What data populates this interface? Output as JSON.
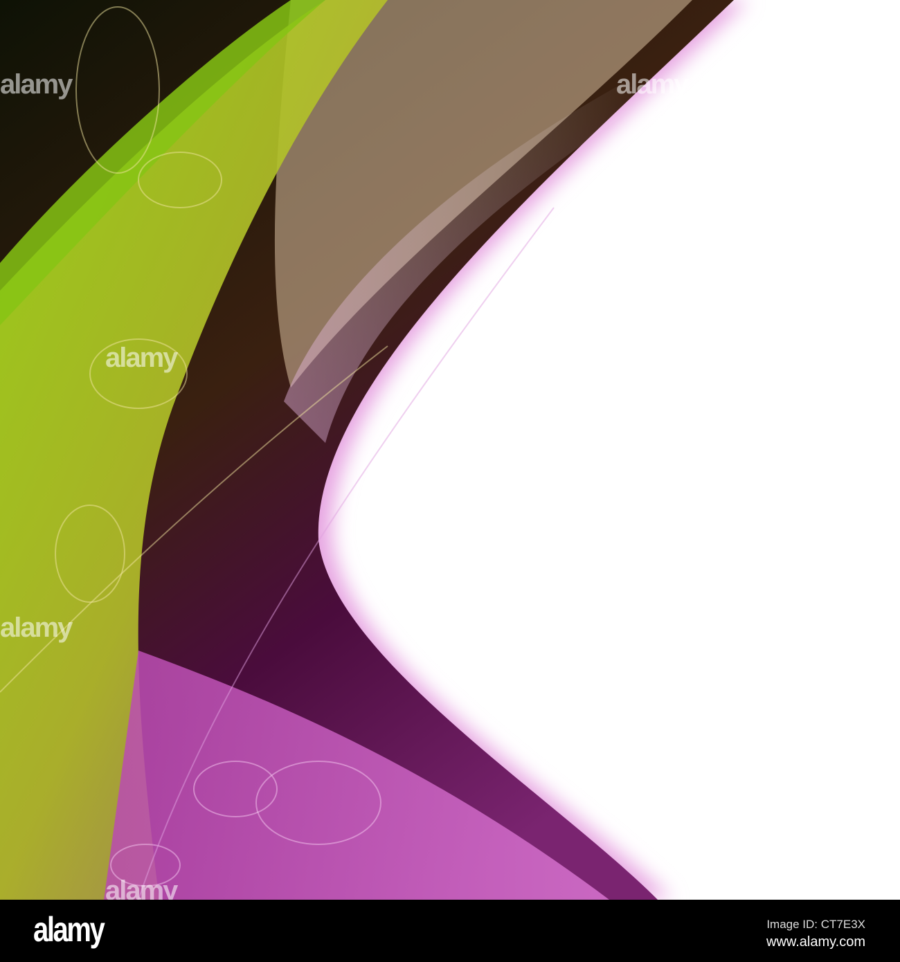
{
  "watermark": {
    "text": "alamy"
  },
  "footer": {
    "logo": "alamy",
    "image_id": "Image ID: CT7E3X",
    "website": "www.alamy.com"
  },
  "colors": {
    "green": "#8fc21a",
    "purple": "#9a2a8f",
    "dark": "#1a1a06",
    "background": "#ffffff"
  }
}
